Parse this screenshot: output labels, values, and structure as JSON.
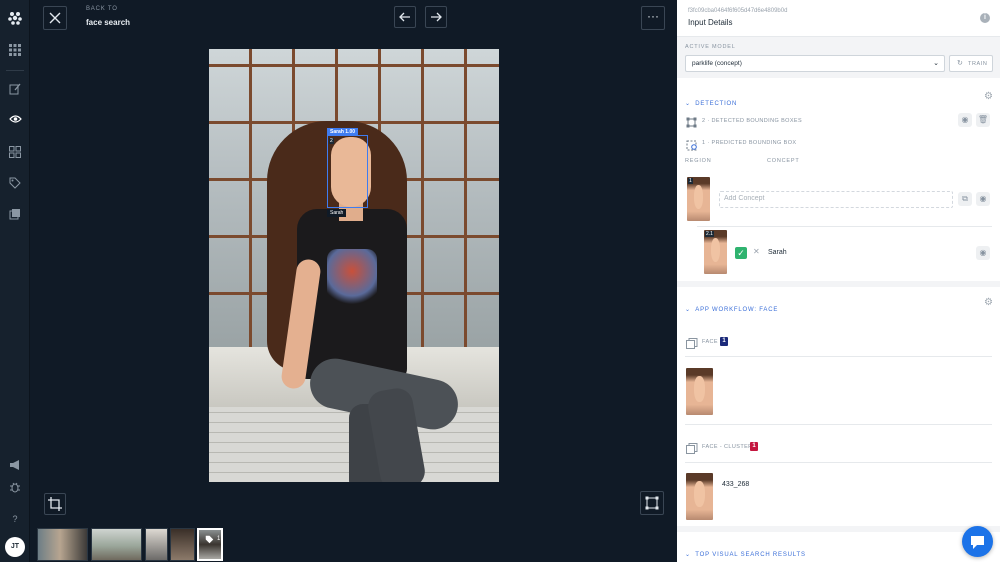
{
  "topbar": {
    "back_small": "BACK TO",
    "back_title": "face search"
  },
  "avatar_initials": "JT",
  "annotation": {
    "tag": "Sarah  1.00",
    "index": "2",
    "name": "Sarah"
  },
  "thumbnails": {
    "selected_badge": "1"
  },
  "panel": {
    "input_id": "f3fc09cba0464f6f605d47d6e4809b0d",
    "title": "Input Details",
    "active_model_label": "ACTIVE MODEL",
    "active_model_value": "parklife (concept)",
    "train_label": "TRAIN",
    "detection": {
      "title": "DETECTION",
      "detected_boxes": "2 · DETECTED BOUNDING BOXES",
      "predicted_box": "1 · PREDICTED BOUNDING BOX",
      "col_region": "REGION",
      "col_concept": "CONCEPT",
      "region1_index": "1",
      "add_concept_placeholder": "Add Concept",
      "region2_index": "2.1",
      "concept_name": "Sarah"
    },
    "workflow": {
      "title": "APP WORKFLOW: FACE",
      "face_label": "FACE",
      "face_count": "1",
      "cluster_label": "FACE - CLUSTER",
      "cluster_count": "1",
      "cluster_id": "433_268"
    },
    "visual_search_title": "TOP VISUAL SEARCH RESULTS"
  },
  "colors": {
    "accent": "#3b6fd8",
    "face_badge": "#1b2a7a",
    "cluster_badge": "#c4163f",
    "check": "#2fb36f",
    "chat": "#1c73e8"
  }
}
